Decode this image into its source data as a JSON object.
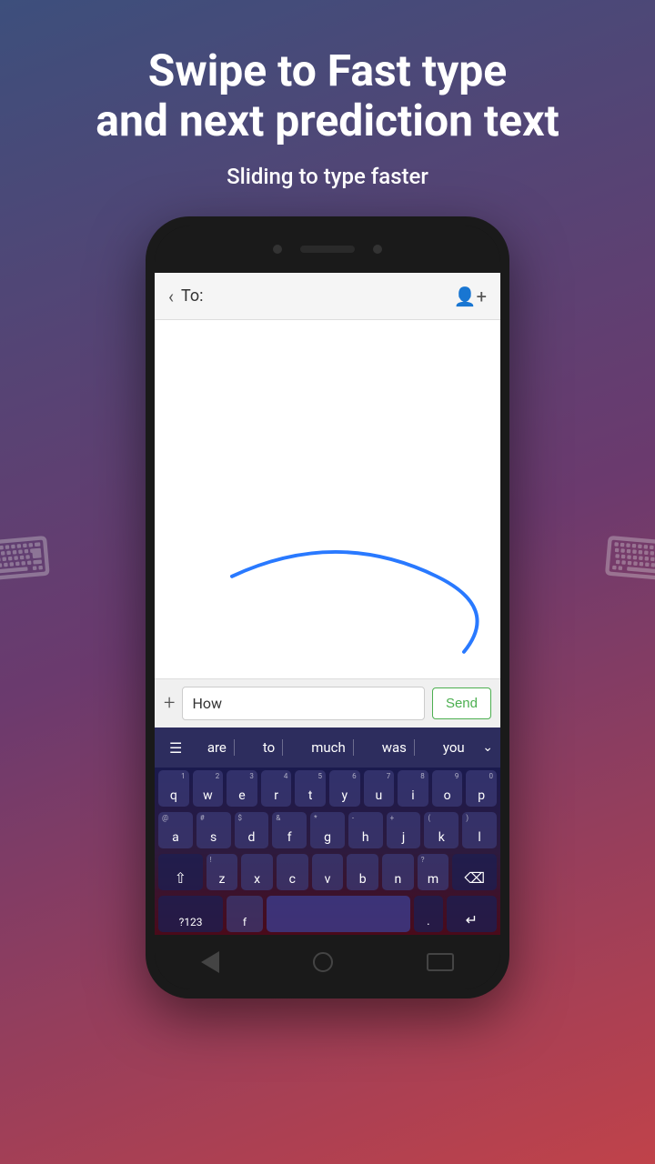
{
  "header": {
    "main_title": "Swipe to Fast type\nand next prediction text",
    "subtitle": "Sliding to type faster"
  },
  "phone": {
    "messaging": {
      "to_label": "To:",
      "input_value": "How",
      "send_button_label": "Send"
    },
    "prediction_bar": {
      "words": [
        "are",
        "to",
        "much",
        "was",
        "you"
      ]
    },
    "keyboard": {
      "rows": [
        [
          "q",
          "w",
          "e",
          "r",
          "t",
          "y",
          "u",
          "i",
          "o",
          "p"
        ],
        [
          "a",
          "s",
          "d",
          "f",
          "g",
          "h",
          "j",
          "k",
          "l"
        ],
        [
          "z",
          "x",
          "c",
          "v",
          "b",
          "n",
          "m"
        ]
      ],
      "num_toggle_label": "?123",
      "comma_label": ",",
      "period_label": ".",
      "row1_nums": [
        "1",
        "2",
        "3",
        "4",
        "5",
        "6",
        "7",
        "8",
        "9",
        "0"
      ],
      "row2_syms": [
        "@",
        "#",
        "$",
        "&",
        "*",
        "-",
        "(",
        ")",
        "’"
      ],
      "row3_syms": [
        "!",
        "?"
      ]
    }
  }
}
